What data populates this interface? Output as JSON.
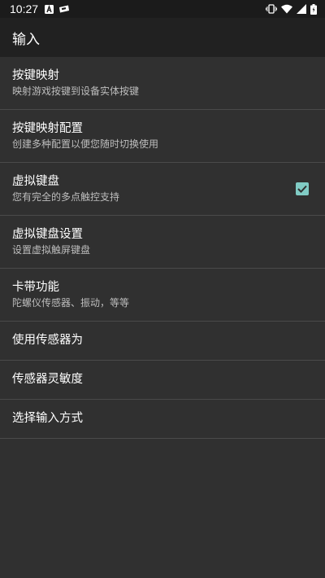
{
  "status_bar": {
    "time": "10:27",
    "icons_left": [
      "a-notification-icon",
      "game-notification-icon"
    ],
    "icons_right": [
      "vibrate-icon",
      "wifi-icon",
      "signal-icon",
      "battery-icon"
    ]
  },
  "app_bar": {
    "title": "输入"
  },
  "settings": [
    {
      "title": "按键映射",
      "summary": "映射游戏按键到设备实体按键"
    },
    {
      "title": "按键映射配置",
      "summary": "创建多种配置以便您随时切换使用"
    },
    {
      "title": "虚拟键盘",
      "summary": "您有完全的多点触控支持",
      "checked": true
    },
    {
      "title": "虚拟键盘设置",
      "summary": "设置虚拟触屏键盘"
    },
    {
      "title": "卡带功能",
      "summary": "陀螺仪传感器、振动，等等"
    },
    {
      "title": "使用传感器为"
    },
    {
      "title": "传感器灵敏度"
    },
    {
      "title": "选择输入方式"
    }
  ],
  "colors": {
    "background": "#303030",
    "app_bar": "#212121",
    "status_bar": "#1b1b1b",
    "checkbox_accent": "#80cbc4",
    "divider": "#4a4a4a"
  }
}
